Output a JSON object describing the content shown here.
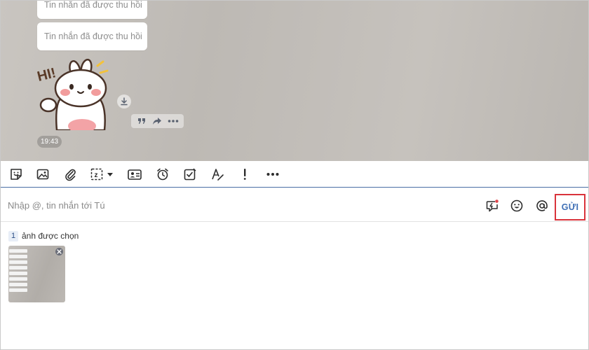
{
  "chat": {
    "messages": [
      {
        "text": "Tin nhắn đã được thu hồi"
      },
      {
        "text": "Tin nhắn đã được thu hồi"
      }
    ],
    "sticker_text": "HI!",
    "time": "19:43"
  },
  "toolbar": {
    "items": [
      "sticker-icon",
      "image-icon",
      "attach-icon",
      "screenshot-icon",
      "contact-card-icon",
      "reminder-icon",
      "todo-icon",
      "format-text-icon",
      "urgent-icon",
      "more-icon"
    ]
  },
  "composer": {
    "placeholder": "Nhập @, tin nhắn tới Tú",
    "send_label": "GỬI"
  },
  "attachments": {
    "count": "1",
    "label": "ảnh được chọn"
  },
  "colors": {
    "accent": "#3f6fb5",
    "highlight": "#d9333b",
    "chat_bg": "#c4c0bb"
  }
}
